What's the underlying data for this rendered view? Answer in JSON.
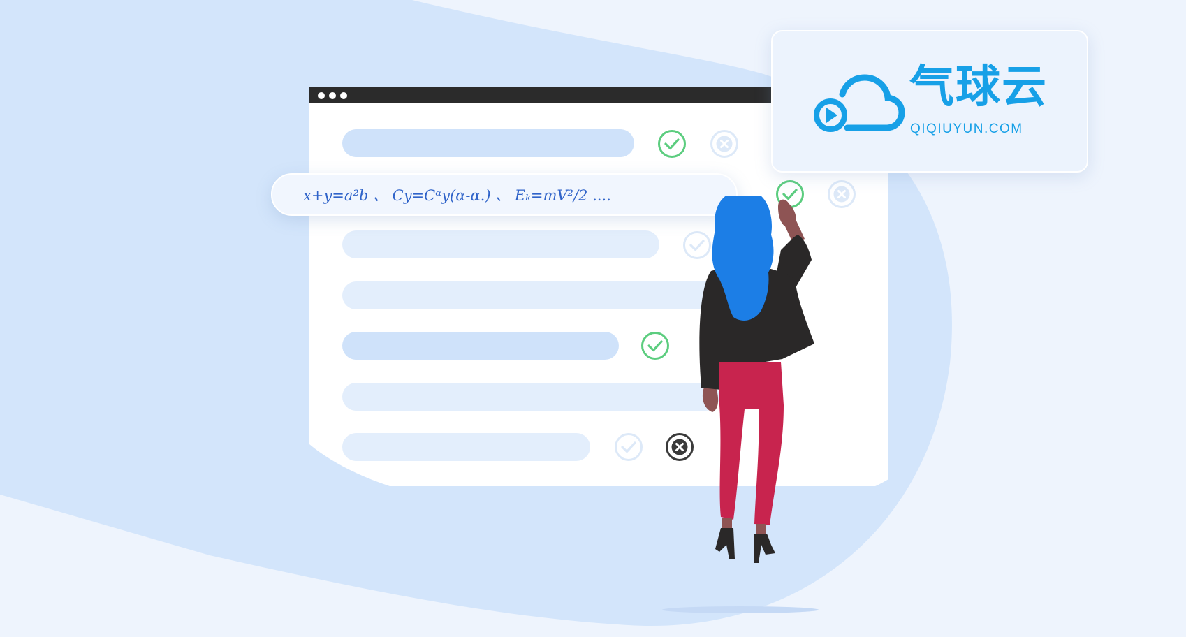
{
  "colors": {
    "background": "#eef4fd",
    "blob": "#d3e5fb",
    "window_bar": "#2b2b2b",
    "check_green": "#5ccd7f",
    "brand_blue": "#17a0e7",
    "formula_blue": "#2f63c9"
  },
  "formula": {
    "text": "x+y=a²b  、 Cy=Cᵅy(α-α.)  、 Eₖ=mV²/2  ...."
  },
  "logo": {
    "icon": "cloud-play-icon",
    "name_cn": "气球云",
    "name_en": "QIQIUYUN.COM"
  },
  "rows": [
    {
      "icon_primary": "check-circle-icon",
      "icon_secondary": "x-circle-icon"
    },
    {
      "icon_primary": "check-circle-icon",
      "icon_secondary": "x-circle-icon"
    },
    {
      "icon_primary": "check-circle-icon"
    },
    {},
    {
      "icon_primary": "check-circle-icon"
    },
    {},
    {
      "icon_primary": "check-circle-icon",
      "icon_secondary": "x-circle-icon"
    }
  ]
}
